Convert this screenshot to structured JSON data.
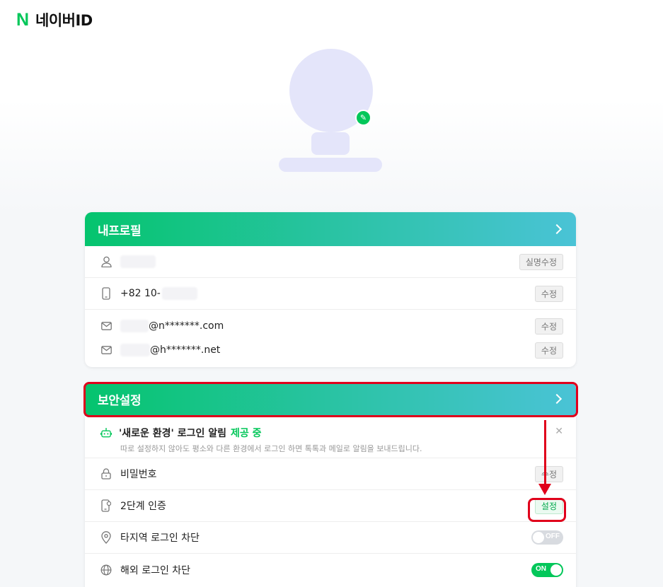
{
  "app": {
    "logo_letter": "N",
    "logo_text": "네이버ID",
    "brand_color": "#03c75a"
  },
  "profile_card": {
    "title": "내프로필",
    "rows": [
      {
        "icon": "user-icon",
        "value": "",
        "button": "실명수정"
      },
      {
        "icon": "phone-icon",
        "value": "+82 10-",
        "button": "수정"
      },
      {
        "icon": "mail-icon",
        "value": "@n*******.com",
        "button": "수정"
      },
      {
        "icon": "mail-icon",
        "value": "@h*******.net",
        "button": "수정"
      }
    ]
  },
  "security_card": {
    "title": "보안설정",
    "notice": {
      "title": "'새로운 환경' 로그인 알림",
      "status": "제공 중",
      "description": "따로 설정하지 않아도 평소와 다른 환경에서 로그인 하면 톡톡과 메일로 알림을 보내드립니다.",
      "close": "✕"
    },
    "rows": [
      {
        "icon": "lock-icon",
        "label": "비밀번호",
        "button": "수정"
      },
      {
        "icon": "two-step-icon",
        "label": "2단계 인증",
        "button": "설정"
      },
      {
        "icon": "location-pin-icon",
        "label": "타지역 로그인 차단",
        "toggle": "OFF"
      },
      {
        "icon": "globe-icon",
        "label": "해외 로그인 차단",
        "toggle": "ON"
      }
    ]
  },
  "annotation": {
    "highlight_color": "#e0001b"
  }
}
